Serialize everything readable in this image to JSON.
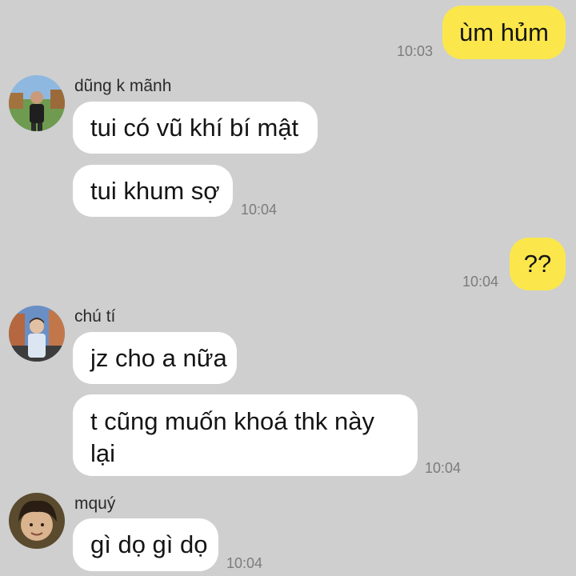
{
  "conversation": {
    "messages": [
      {
        "direction": "outgoing",
        "text": "ùm hủm",
        "time": "10:03"
      },
      {
        "direction": "incoming",
        "sender": "dũng k mãnh",
        "avatar_icon": "user-avatar-photo-icon",
        "text": "tui có vũ khí bí mật"
      },
      {
        "direction": "incoming",
        "text": "tui khum sợ",
        "time": "10:04"
      },
      {
        "direction": "outgoing",
        "text": "??",
        "time": "10:04"
      },
      {
        "direction": "incoming",
        "sender": "chú tí",
        "avatar_icon": "user-avatar-photo-icon",
        "text": "jz cho a nữa"
      },
      {
        "direction": "incoming",
        "text": "t cũng muốn khoá thk này lại",
        "time": "10:04"
      },
      {
        "direction": "incoming",
        "sender": "mquý",
        "avatar_icon": "user-avatar-photo-icon",
        "text": "gì dọ gì dọ",
        "time": "10:04"
      }
    ]
  },
  "colors": {
    "background": "#cfcfcf",
    "incoming_bubble": "#ffffff",
    "outgoing_bubble": "#fbe74b",
    "timestamp": "#7c7c7c"
  }
}
